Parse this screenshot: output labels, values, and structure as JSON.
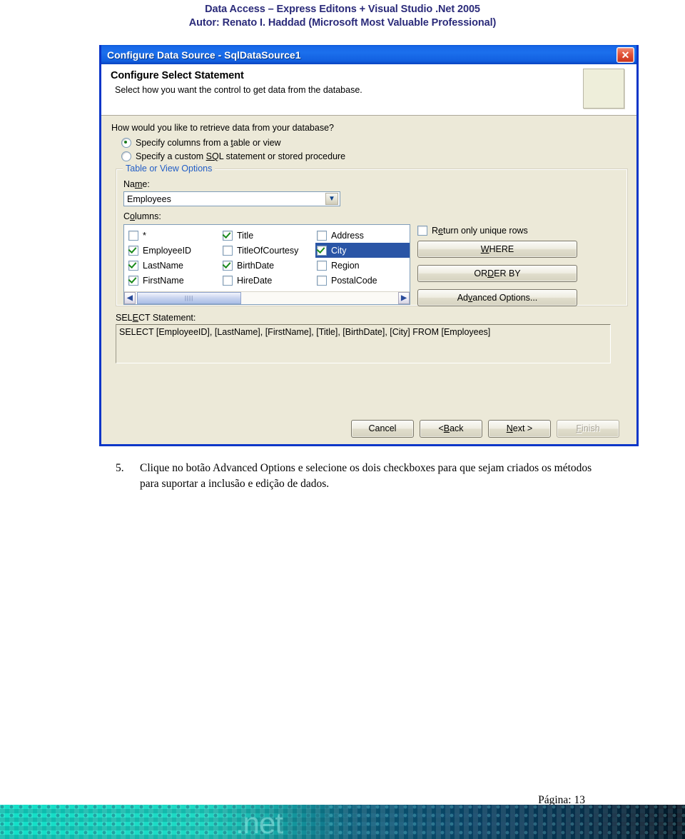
{
  "document": {
    "header_line1": "Data Access – Express Editons + Visual Studio .Net 2005",
    "header_line2": "Autor: Renato I. Haddad (Microsoft Most Valuable Professional)",
    "instruction_number": "5.",
    "instruction_text": "Clique no botão Advanced Options e selecione os dois checkboxes para que sejam criados os métodos para suportar a inclusão e edição de dados.",
    "page_label": "Página: 13",
    "footer_brand": ".net",
    "header_color": "#2b2b7a"
  },
  "dialog": {
    "title": "Configure Data Source - SqlDataSource1",
    "close_icon": "close-icon",
    "banner": {
      "heading": "Configure Select Statement",
      "subtext": "Select how you want the control to get data from the database."
    },
    "question_label": "How would you like to retrieve data from your database?",
    "radios": [
      {
        "label_pre": "Specify columns from a ",
        "label_accel": "t",
        "label_post": "able or view",
        "checked": true
      },
      {
        "label_pre": "Specify a custom ",
        "label_accel": "SQ",
        "label_post": "L statement or stored procedure",
        "checked": false
      }
    ],
    "group": {
      "legend": "Table or View Options",
      "name_label_pre": "Na",
      "name_label_accel": "m",
      "name_label_post": "e:",
      "name_value": "Employees",
      "dropdown_icon": "chevron-down-icon",
      "columns_label_pre": "C",
      "columns_label_accel": "o",
      "columns_label_post": "lumns:",
      "columns": [
        [
          {
            "label": "*",
            "checked": false,
            "selected": false
          },
          {
            "label": "EmployeeID",
            "checked": true,
            "selected": false
          },
          {
            "label": "LastName",
            "checked": true,
            "selected": false
          },
          {
            "label": "FirstName",
            "checked": true,
            "selected": false
          }
        ],
        [
          {
            "label": "Title",
            "checked": true,
            "selected": false
          },
          {
            "label": "TitleOfCourtesy",
            "checked": false,
            "selected": false
          },
          {
            "label": "BirthDate",
            "checked": true,
            "selected": false
          },
          {
            "label": "HireDate",
            "checked": false,
            "selected": false
          }
        ],
        [
          {
            "label": "Address",
            "checked": false,
            "selected": false
          },
          {
            "label": "City",
            "checked": true,
            "selected": true
          },
          {
            "label": "Region",
            "checked": false,
            "selected": false
          },
          {
            "label": "PostalCode",
            "checked": false,
            "selected": false
          }
        ]
      ],
      "scroll_left_icon": "chevron-left-icon",
      "scroll_right_icon": "chevron-right-icon",
      "scroll_thumb_grip": "||||",
      "unique_rows": {
        "label_pre": "R",
        "label_accel": "e",
        "label_post": "turn only unique rows",
        "checked": false
      },
      "where_button": {
        "pre": "",
        "accel": "W",
        "post": "HERE"
      },
      "orderby_button": {
        "pre": "OR",
        "accel": "D",
        "post": "ER BY"
      },
      "advanced_button": {
        "pre": "Ad",
        "accel": "v",
        "post": "anced Options..."
      }
    },
    "select_statement": {
      "label_pre": "SEL",
      "label_accel": "E",
      "label_post": "CT Statement:",
      "value": "SELECT [EmployeeID], [LastName], [FirstName], [Title], [BirthDate], [City] FROM [Employees]"
    },
    "footer_buttons": [
      {
        "pre": "Cancel",
        "accel": "",
        "post": "",
        "disabled": false
      },
      {
        "pre": "< ",
        "accel": "B",
        "post": "ack",
        "disabled": false
      },
      {
        "pre": "",
        "accel": "N",
        "post": "ext >",
        "disabled": false
      },
      {
        "pre": "",
        "accel": "F",
        "post": "inish",
        "disabled": true
      }
    ]
  },
  "colors": {
    "title_gradient_start": "#0a56d6",
    "title_gradient_end": "#0a44c0",
    "dialog_border": "#0a36c8",
    "dialog_bg": "#ece9d8",
    "selection_blue": "#2a55a6",
    "legend_blue": "#215dc6",
    "check_green": "#1a8a1a",
    "footer_teal": "#12e0c8"
  }
}
